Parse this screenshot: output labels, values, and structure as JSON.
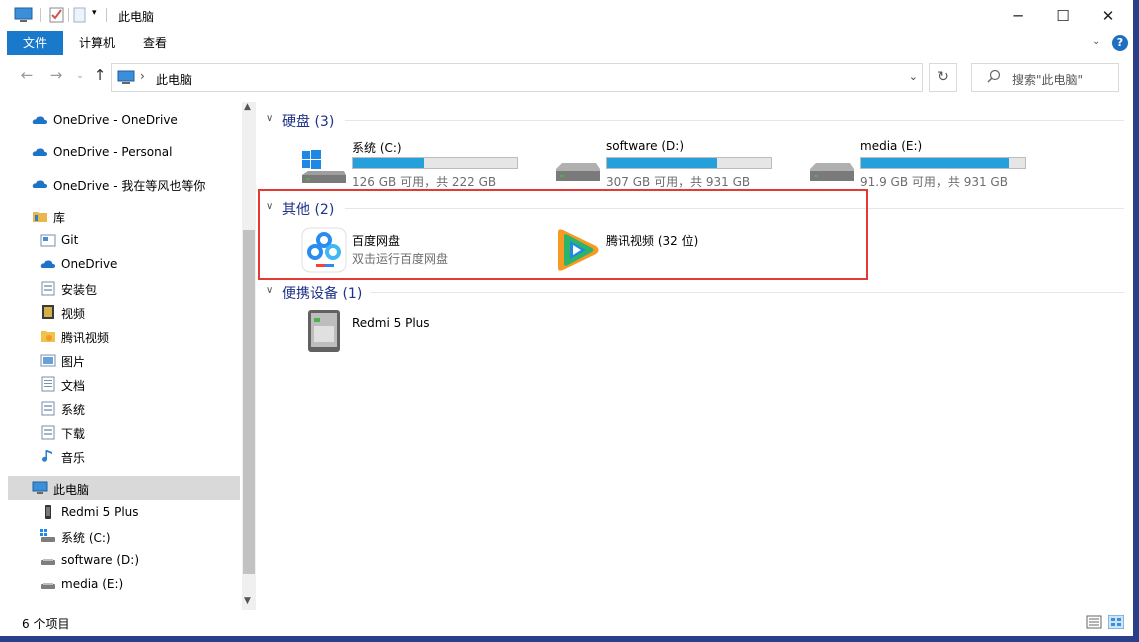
{
  "window": {
    "title": "此电脑",
    "controls": {
      "minimize": "─",
      "maximize": "☐",
      "close": "✕"
    }
  },
  "ribbon": {
    "tabs": [
      "文件",
      "计算机",
      "查看"
    ],
    "help": "?"
  },
  "address": {
    "crumb": "此电脑",
    "search_placeholder": "搜索\"此电脑\""
  },
  "sidebar": {
    "items": [
      {
        "label": "OneDrive - OneDrive",
        "icon": "cloud-icon"
      },
      {
        "label": "OneDrive - Personal",
        "icon": "cloud-icon"
      },
      {
        "label": "OneDrive - 我在等风也等你",
        "icon": "cloud-icon"
      },
      {
        "label": "库",
        "icon": "library-icon"
      },
      {
        "label": "Git",
        "icon": "library-folder-icon"
      },
      {
        "label": "OneDrive",
        "icon": "cloud-icon"
      },
      {
        "label": "安装包",
        "icon": "library-folder-icon"
      },
      {
        "label": "视频",
        "icon": "video-library-icon"
      },
      {
        "label": "腾讯视频",
        "icon": "tencent-folder-icon"
      },
      {
        "label": "图片",
        "icon": "picture-library-icon"
      },
      {
        "label": "文档",
        "icon": "document-library-icon"
      },
      {
        "label": "系统",
        "icon": "library-folder-icon"
      },
      {
        "label": "下载",
        "icon": "library-folder-icon"
      },
      {
        "label": "音乐",
        "icon": "music-icon"
      },
      {
        "label": "此电脑",
        "icon": "computer-icon"
      },
      {
        "label": "Redmi 5 Plus",
        "icon": "phone-icon"
      },
      {
        "label": "系统 (C:)",
        "icon": "drive-icon"
      },
      {
        "label": "software (D:)",
        "icon": "drive-icon"
      },
      {
        "label": "media (E:)",
        "icon": "drive-icon"
      }
    ]
  },
  "groups": {
    "disks": "硬盘 (3)",
    "other": "其他 (2)",
    "portable": "便携设备 (1)"
  },
  "drives": [
    {
      "name": "系统 (C:)",
      "free": "126 GB 可用，共 222 GB",
      "used_fraction": 0.43
    },
    {
      "name": "software (D:)",
      "free": "307 GB 可用，共 931 GB",
      "used_fraction": 0.67
    },
    {
      "name": "media (E:)",
      "free": "91.9 GB 可用，共 931 GB",
      "used_fraction": 0.9
    }
  ],
  "other_items": [
    {
      "name": "百度网盘",
      "sub": "双击运行百度网盘"
    },
    {
      "name": "腾讯视频 (32 位)"
    }
  ],
  "portable_items": [
    {
      "name": "Redmi 5 Plus"
    }
  ],
  "status": {
    "count": "6 个项目"
  },
  "colors": {
    "accent": "#1979ca",
    "bar_fill": "#26a0da",
    "group_title": "#1e3287",
    "highlight": "#e53935"
  }
}
